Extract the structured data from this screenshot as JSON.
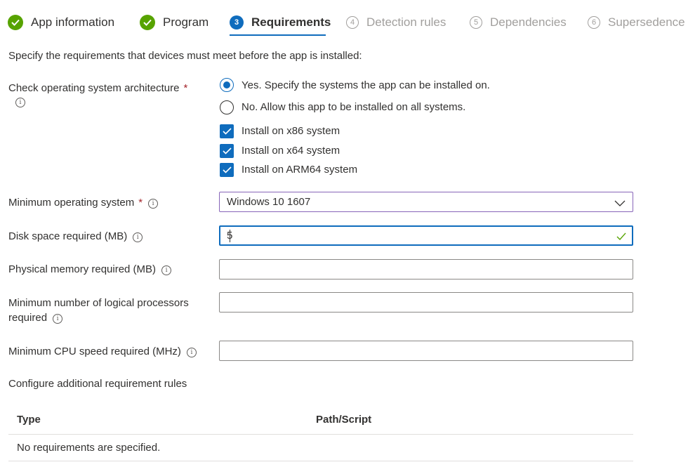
{
  "steps": [
    {
      "label": "App information",
      "state": "done"
    },
    {
      "label": "Program",
      "state": "done"
    },
    {
      "label": "Requirements",
      "state": "active",
      "number": "3"
    },
    {
      "label": "Detection rules",
      "state": "todo",
      "number": "4"
    },
    {
      "label": "Dependencies",
      "state": "todo",
      "number": "5"
    },
    {
      "label": "Supersedence",
      "state": "todo",
      "number": "6"
    }
  ],
  "intro": "Specify the requirements that devices must meet before the app is installed:",
  "architecture": {
    "label": "Check operating system architecture",
    "required_mark": "*",
    "options": [
      {
        "label": "Yes. Specify the systems the app can be installed on.",
        "selected": true
      },
      {
        "label": "No. Allow this app to be installed on all systems.",
        "selected": false
      }
    ],
    "checkboxes": [
      {
        "label": "Install on x86 system",
        "checked": true
      },
      {
        "label": "Install on x64 system",
        "checked": true
      },
      {
        "label": "Install on ARM64 system",
        "checked": true
      }
    ]
  },
  "min_os": {
    "label": "Minimum operating system",
    "required_mark": "*",
    "value": "Windows 10 1607"
  },
  "disk_space": {
    "label": "Disk space required (MB)",
    "value": "5"
  },
  "physical_memory": {
    "label": "Physical memory required (MB)",
    "value": ""
  },
  "logical_processors": {
    "label_line1": "Minimum number of logical processors",
    "label_line2": "required",
    "value": ""
  },
  "cpu_speed": {
    "label": "Minimum CPU speed required (MHz)",
    "value": ""
  },
  "additional_rules": {
    "label": "Configure additional requirement rules",
    "columns": [
      "Type",
      "Path/Script"
    ],
    "empty_text": "No requirements are specified."
  },
  "icons": {
    "info": "i",
    "done": "checkmark-circle",
    "dropdown": "chevron-down",
    "valid": "checkmark"
  },
  "colors": {
    "accent": "#0f6cbd",
    "success": "#57a300",
    "required": "#a4262c",
    "dropdown_border": "#8764b8"
  }
}
